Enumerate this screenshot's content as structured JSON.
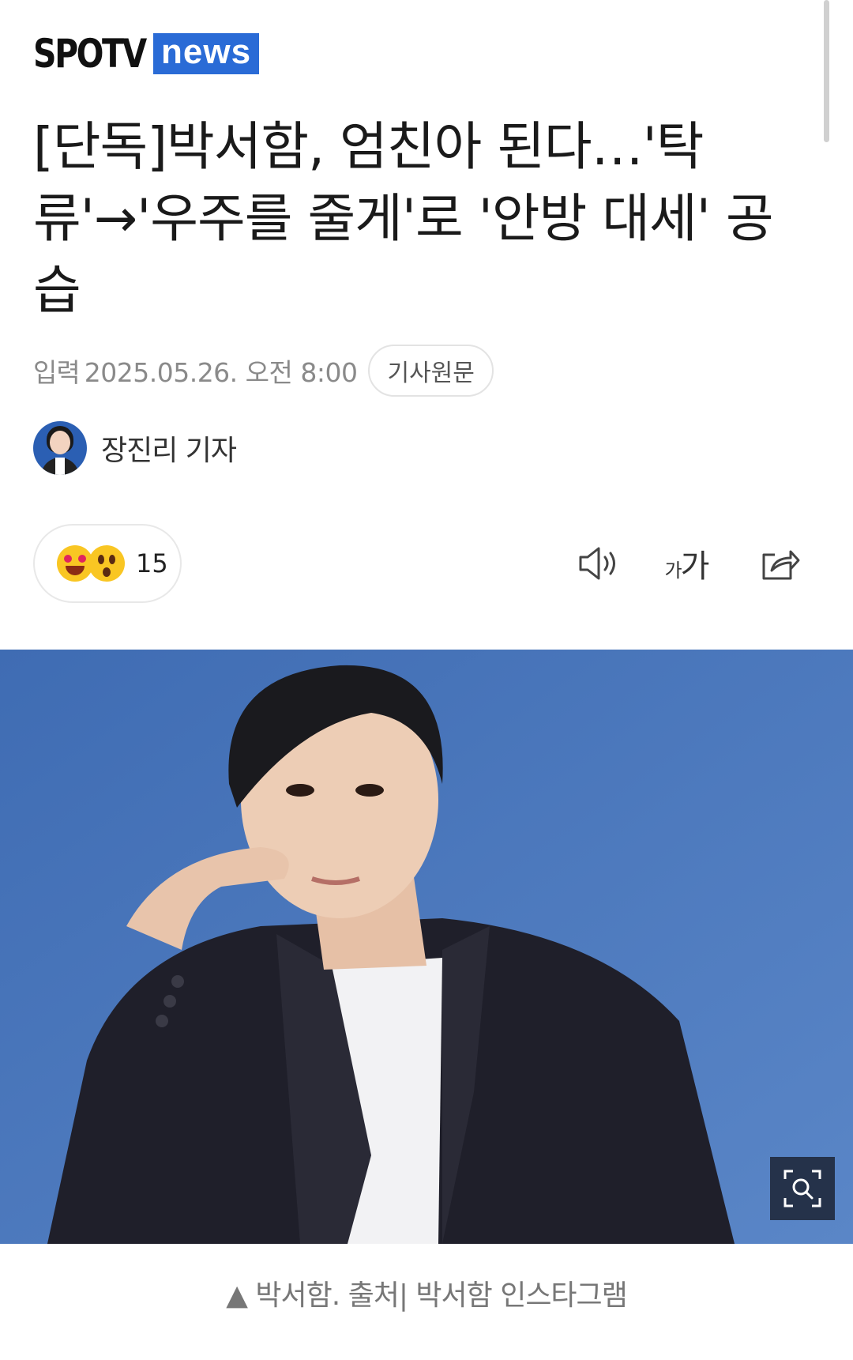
{
  "logo": {
    "brand": "SPOTV",
    "sub": "news",
    "brand_color": "#2a6bd6"
  },
  "headline": "[단독]박서함, 엄친아 된다…'탁류'→'우주를 줄게'로 '안방 대세' 공습",
  "meta": {
    "label": "입력",
    "date": "2025.05.26. 오전 8:00",
    "original_button": "기사원문"
  },
  "reporter": {
    "name": "장진리 기자"
  },
  "reaction": {
    "count": "15",
    "emojis": [
      "heart-eyes-emoji",
      "surprised-emoji"
    ]
  },
  "tools": {
    "font_small": "가",
    "font_large": "가",
    "icons": [
      "speaker-icon",
      "font-size-icon",
      "share-icon"
    ]
  },
  "photo": {
    "zoom_icon": "zoom-search-icon"
  },
  "caption": "▲ 박서함. 출처| 박서함 인스타그램"
}
